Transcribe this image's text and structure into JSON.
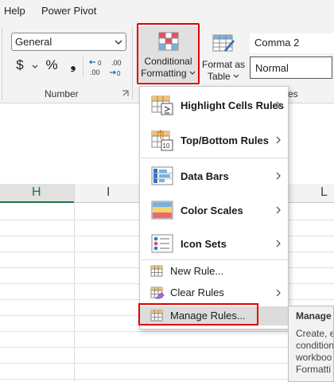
{
  "menu_tabs": [
    "Help",
    "Power Pivot"
  ],
  "ribbon": {
    "number_format": {
      "value": "General"
    },
    "number_buttons": {
      "currency": "$",
      "percent": "%",
      "comma": "❟",
      "increase_decimal": ".00",
      "decrease_decimal": ".00"
    },
    "number_group_label": "Number",
    "conditional_formatting": {
      "line1": "Conditional",
      "line2": "Formatting"
    },
    "format_as_table": {
      "line1": "Format as",
      "line2": "Table"
    },
    "cell_styles": [
      "Comma 2",
      "Normal"
    ],
    "styles_group_label_partial": "es"
  },
  "sheet": {
    "column_headers": [
      "H",
      "I",
      "L"
    ],
    "selected_column": "H",
    "accent_color": "#217346"
  },
  "cf_menu": {
    "items": [
      {
        "label": "Highlight Cells Rules",
        "icon": "highlight-cells-icon",
        "has_submenu": true
      },
      {
        "label": "Top/Bottom Rules",
        "icon": "top-bottom-icon",
        "has_submenu": true
      },
      {
        "label": "Data Bars",
        "icon": "data-bars-icon",
        "has_submenu": true
      },
      {
        "label": "Color Scales",
        "icon": "color-scales-icon",
        "has_submenu": true
      },
      {
        "label": "Icon Sets",
        "icon": "icon-sets-icon",
        "has_submenu": true
      },
      {
        "label": "New Rule...",
        "icon": "new-rule-icon",
        "has_submenu": false
      },
      {
        "label": "Clear Rules",
        "icon": "clear-rules-icon",
        "has_submenu": true
      },
      {
        "label": "Manage Rules...",
        "icon": "manage-rules-icon",
        "has_submenu": false
      }
    ],
    "hovered_item": "Manage Rules...",
    "highlight_color": "#e00000"
  },
  "tooltip": {
    "title": "Manage",
    "lines": [
      "Create, e",
      "condition",
      "workboo",
      "Formatti"
    ]
  }
}
